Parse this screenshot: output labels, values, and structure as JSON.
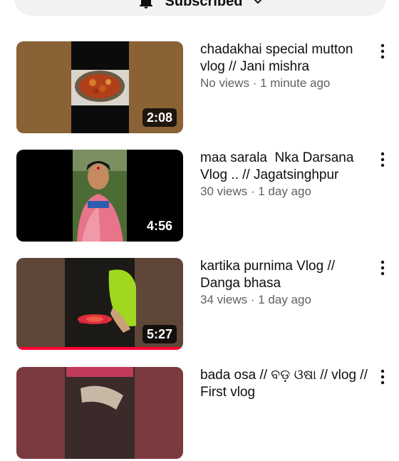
{
  "subscribe": {
    "label": "Subscribed",
    "icon": "bell-icon"
  },
  "videos": [
    {
      "title": "chadakhai special mutton vlog // Jani mishra",
      "views": "No views",
      "age": "1 minute ago",
      "duration": "2:08",
      "watched_fraction": 0
    },
    {
      "title": "maa sarala  Nka Darsana Vlog .. // Jagatsinghpur",
      "views": "30 views",
      "age": "1 day ago",
      "duration": "4:56",
      "watched_fraction": 0
    },
    {
      "title": "kartika purnima Vlog // Danga bhasa",
      "views": "34 views",
      "age": "1 day ago",
      "duration": "5:27",
      "watched_fraction": 1.0
    },
    {
      "title": "bada osa // ବଡ଼ ଓଷା // vlog // First vlog",
      "views": "",
      "age": "",
      "duration": "",
      "watched_fraction": 0
    }
  ],
  "colors": {
    "accent_red": "#ff0033",
    "meta_gray": "#606060"
  },
  "stats_separator": " · "
}
